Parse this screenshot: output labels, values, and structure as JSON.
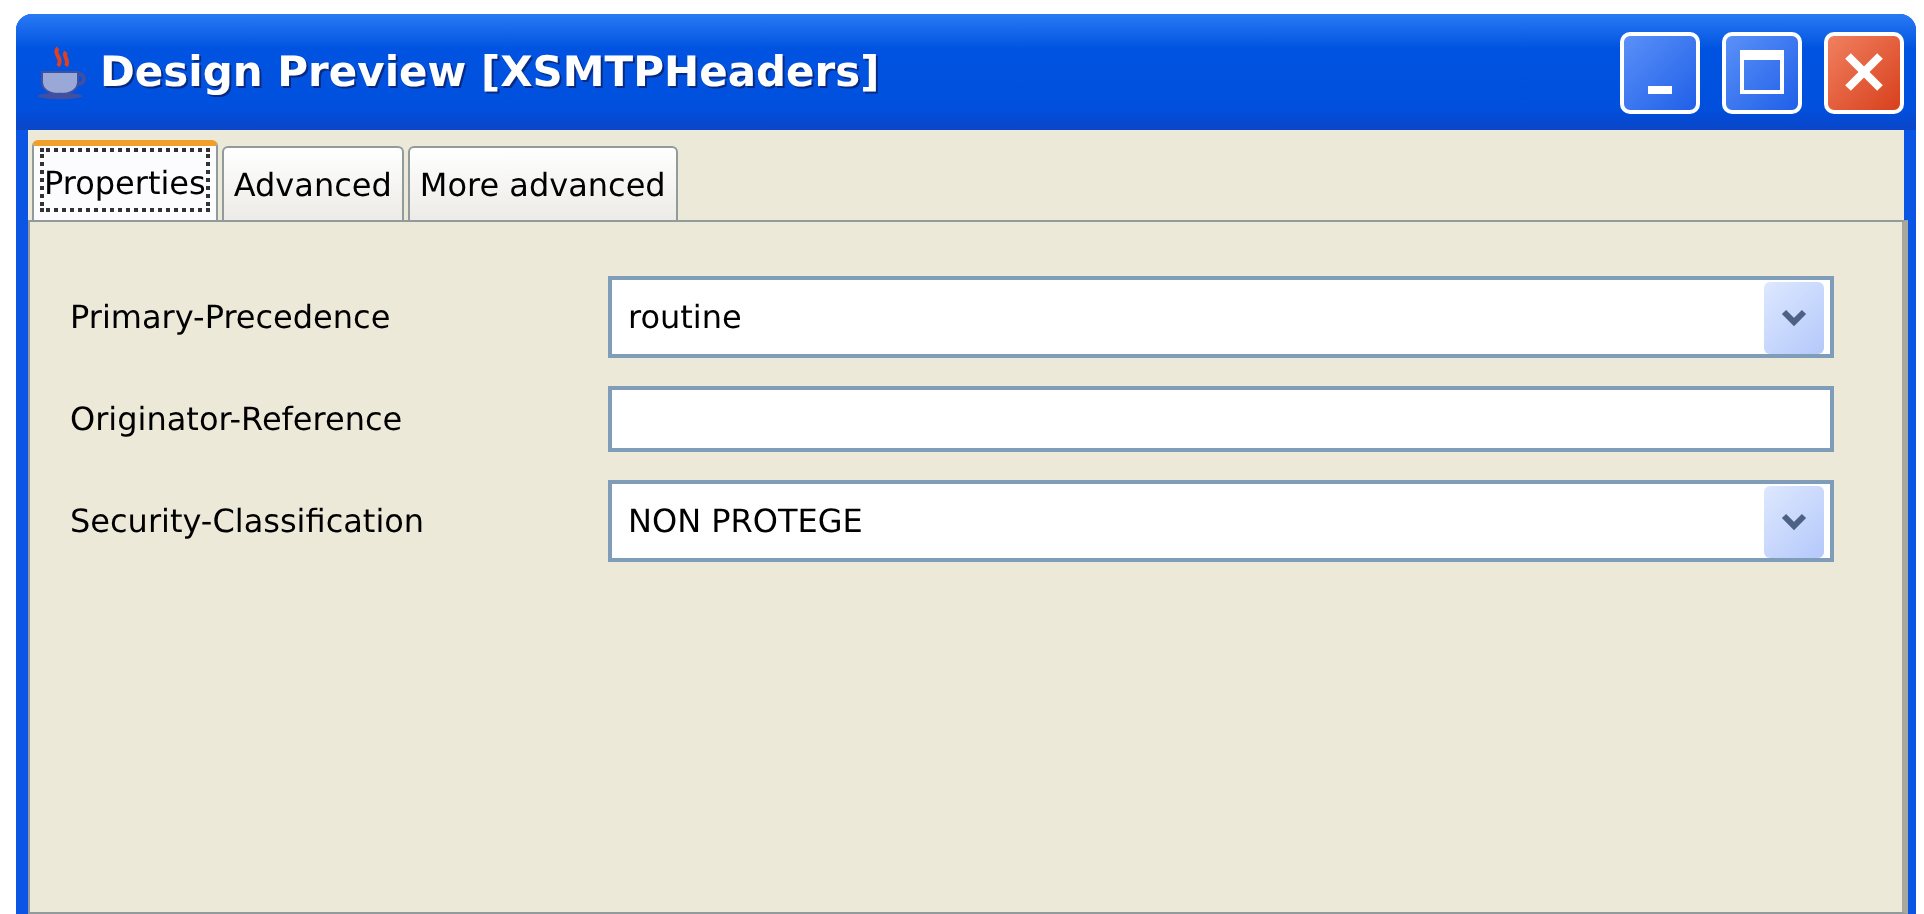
{
  "window": {
    "title": "Design Preview [XSMTPHeaders]"
  },
  "tabs": [
    {
      "label": "Properties",
      "selected": true
    },
    {
      "label": "Advanced",
      "selected": false
    },
    {
      "label": "More advanced",
      "selected": false
    }
  ],
  "fields": [
    {
      "label": "Primary-Precedence",
      "kind": "combo",
      "value": "routine"
    },
    {
      "label": "Originator-Reference",
      "kind": "text"
    },
    {
      "label": "Security-Classification",
      "kind": "combo",
      "value": "NON PROTEGE"
    }
  ]
}
